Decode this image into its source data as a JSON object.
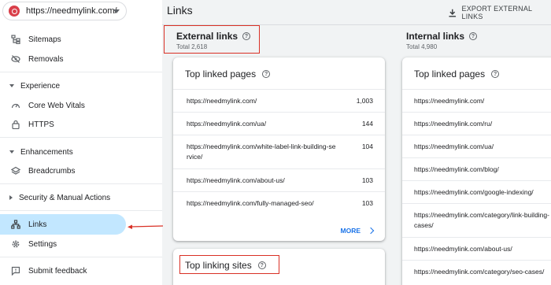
{
  "property": {
    "url": "https://needmylink.com/"
  },
  "sidebar": {
    "items_top": [
      {
        "label": "Sitemaps",
        "icon": "sitemap-icon"
      },
      {
        "label": "Removals",
        "icon": "eye-off-icon"
      }
    ],
    "experience": {
      "label": "Experience",
      "items": [
        {
          "label": "Core Web Vitals",
          "icon": "gauge-icon"
        },
        {
          "label": "HTTPS",
          "icon": "lock-icon"
        }
      ]
    },
    "enhancements": {
      "label": "Enhancements",
      "items": [
        {
          "label": "Breadcrumbs",
          "icon": "layers-icon"
        }
      ]
    },
    "security": {
      "label": "Security & Manual Actions"
    },
    "links": {
      "label": "Links",
      "icon": "network-icon"
    },
    "settings": {
      "label": "Settings",
      "icon": "gear-icon"
    },
    "feedback": {
      "label": "Submit feedback",
      "icon": "feedback-icon"
    }
  },
  "header": {
    "title": "Links",
    "export_label": "EXPORT EXTERNAL LINKS"
  },
  "external": {
    "title": "External links",
    "total": "Total 2,618",
    "top_pages_title": "Top linked pages",
    "rows": [
      {
        "url": "https://needmylink.com/",
        "count": "1,003"
      },
      {
        "url": "https://needmylink.com/ua/",
        "count": "144"
      },
      {
        "url": "https://needmylink.com/white-label-link-building-service/",
        "count": "104"
      },
      {
        "url": "https://needmylink.com/about-us/",
        "count": "103"
      },
      {
        "url": "https://needmylink.com/fully-managed-seo/",
        "count": "103"
      }
    ],
    "more_label": "MORE",
    "top_sites_title": "Top linking sites"
  },
  "internal": {
    "title": "Internal links",
    "total": "Total 4,980",
    "top_pages_title": "Top linked pages",
    "rows": [
      {
        "url": "https://needmylink.com/"
      },
      {
        "url": "https://needmylink.com/ru/"
      },
      {
        "url": "https://needmylink.com/ua/"
      },
      {
        "url": "https://needmylink.com/blog/"
      },
      {
        "url": "https://needmylink.com/google-indexing/"
      },
      {
        "url": "https://needmylink.com/category/link-building-cases/"
      },
      {
        "url": "https://needmylink.com/about-us/"
      },
      {
        "url": "https://needmylink.com/category/seo-cases/"
      }
    ]
  },
  "colors": {
    "accent": "#1a73e8",
    "active_bg": "#c2e7ff",
    "highlight": "#d93025"
  }
}
